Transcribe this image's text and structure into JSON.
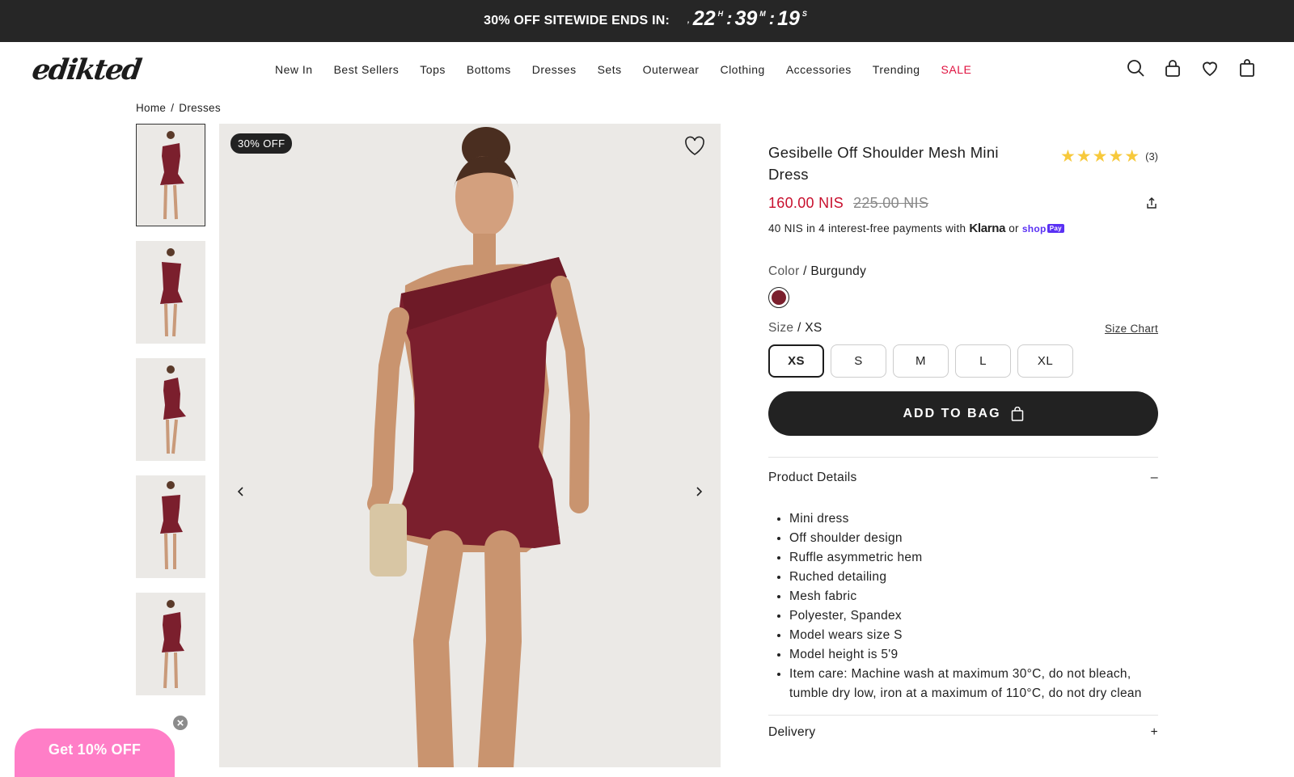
{
  "promo": {
    "text": "30% OFF SITEWIDE ENDS IN:",
    "hours": "22",
    "hours_unit": "H",
    "minutes": "39",
    "minutes_unit": "M",
    "seconds": "19",
    "seconds_unit": "S"
  },
  "brand": {
    "logo": "edikted"
  },
  "nav": [
    "New In",
    "Best Sellers",
    "Tops",
    "Bottoms",
    "Dresses",
    "Sets",
    "Outerwear",
    "Clothing",
    "Accessories",
    "Trending",
    "SALE"
  ],
  "header_icons": [
    "search-icon",
    "account-icon",
    "wishlist-icon",
    "bag-icon"
  ],
  "breadcrumb": {
    "home": "Home",
    "sep": "/",
    "current": "Dresses"
  },
  "gallery": {
    "badge": "30% OFF",
    "thumbnail_count": 5,
    "dress_color": "#7b1f2d"
  },
  "product": {
    "title": "Gesibelle Off Shoulder Mesh Mini Dress",
    "stars": "★★★★★",
    "rating_value": 5,
    "review_count": "(3)",
    "price": "160.00 NIS",
    "old_price": "225.00 NIS",
    "installments_text": "40 NIS in 4 interest-free payments with",
    "klarna": "Klarna",
    "or": "or",
    "shop": "shop",
    "pay": "Pay",
    "color_label": "Color",
    "color_sep": " / ",
    "color_value": "Burgundy",
    "size_label": "Size",
    "size_sep": " / ",
    "size_value": "XS",
    "size_chart": "Size Chart",
    "sizes": [
      "XS",
      "S",
      "M",
      "L",
      "XL"
    ],
    "add_to_bag": "ADD TO BAG",
    "details_title": "Product Details",
    "details_toggle": "–",
    "details": [
      "Mini dress",
      "Off shoulder design",
      "Ruffle asymmetric hem",
      "Ruched detailing",
      "Mesh fabric",
      "Polyester, Spandex",
      "Model wears size S",
      "Model height is 5'9",
      "Item care: Machine wash at maximum 30°C, do not bleach, tumble dry low, iron at a maximum of 110°C, do not dry clean"
    ],
    "delivery_title": "Delivery",
    "delivery_toggle": "+"
  },
  "popup": {
    "label": "Get 10% OFF",
    "close": "×"
  },
  "colors": {
    "accent_red": "#c8102e",
    "sale_red": "#e0113f",
    "dark": "#222222",
    "pink": "#ff7ec7",
    "burgundy": "#7b1f2d"
  }
}
